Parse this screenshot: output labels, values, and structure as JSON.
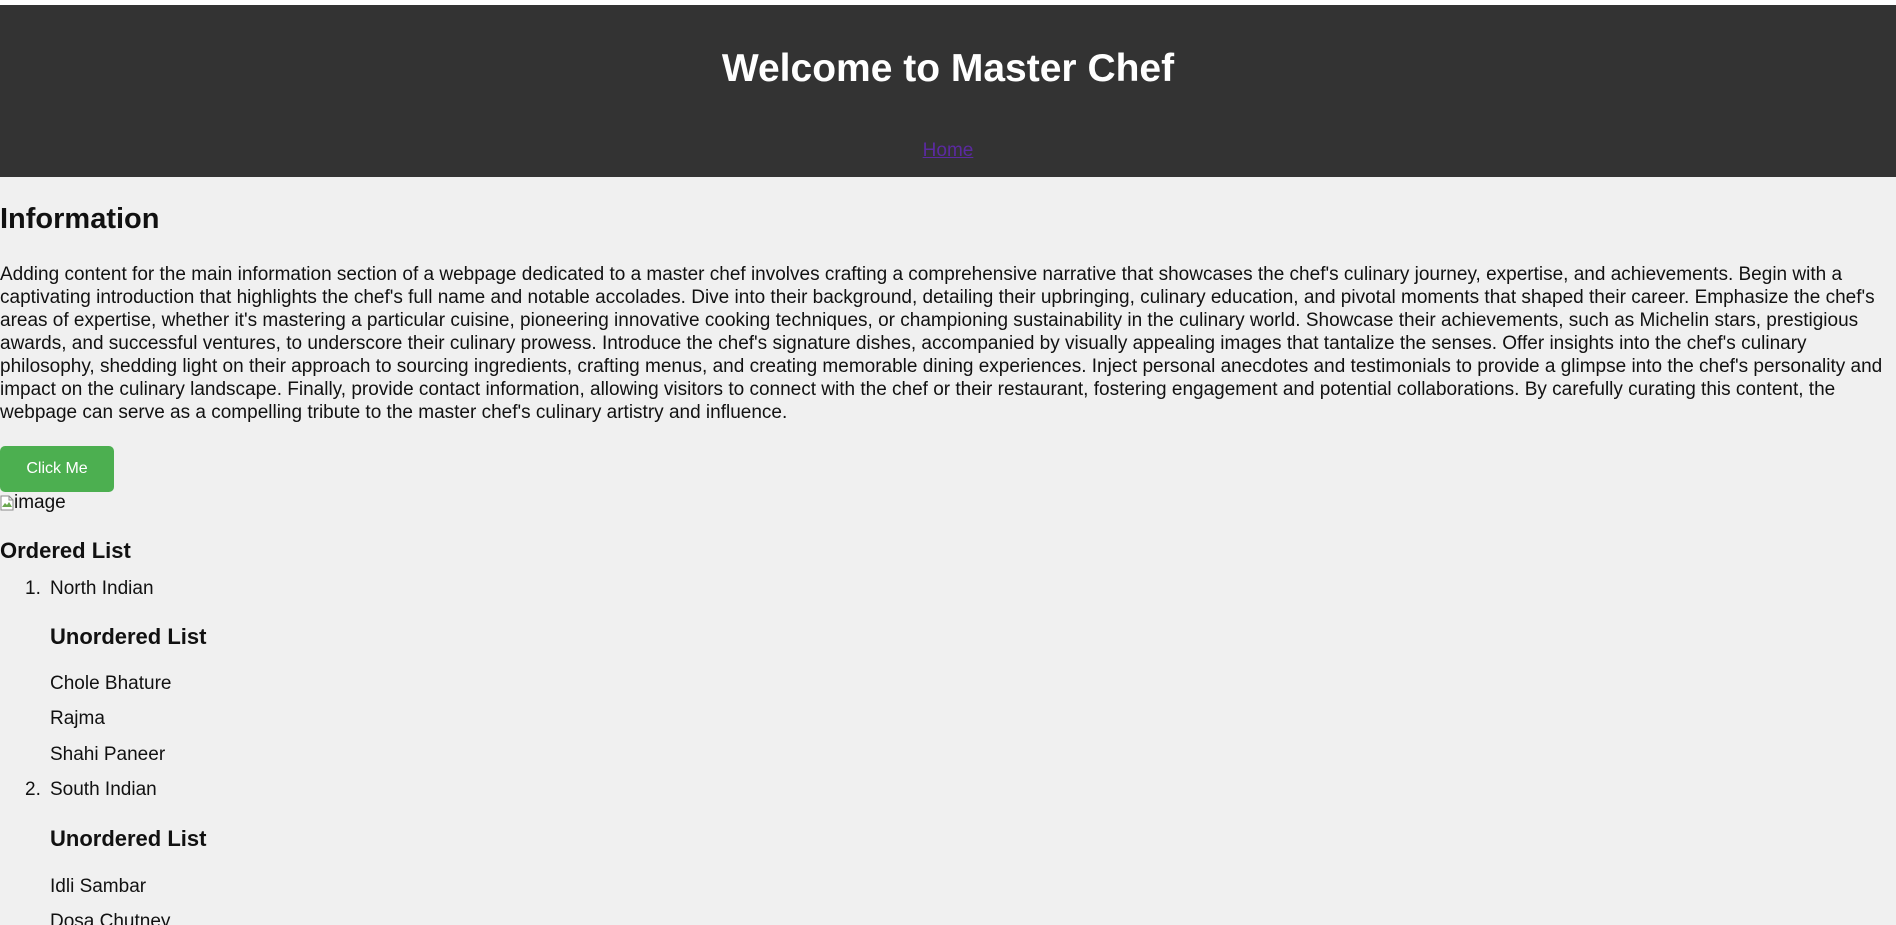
{
  "header": {
    "title": "Welcome to Master Chef",
    "nav": {
      "home_label": "Home"
    }
  },
  "main": {
    "section_title": "Information",
    "paragraph": "Adding content for the main information section of a webpage dedicated to a master chef involves crafting a comprehensive narrative that showcases the chef's culinary journey, expertise, and achievements. Begin with a captivating introduction that highlights the chef's full name and notable accolades. Dive into their background, detailing their upbringing, culinary education, and pivotal moments that shaped their career. Emphasize the chef's areas of expertise, whether it's mastering a particular cuisine, pioneering innovative cooking techniques, or championing sustainability in the culinary world. Showcase their achievements, such as Michelin stars, prestigious awards, and successful ventures, to underscore their culinary prowess. Introduce the chef's signature dishes, accompanied by visually appealing images that tantalize the senses. Offer insights into the chef's culinary philosophy, shedding light on their approach to sourcing ingredients, crafting menus, and creating memorable dining experiences. Inject personal anecdotes and testimonials to provide a glimpse into the chef's personality and impact on the culinary landscape. Finally, provide contact information, allowing visitors to connect with the chef or their restaurant, fostering engagement and potential collaborations. By carefully curating this content, the webpage can serve as a compelling tribute to the master chef's culinary artistry and influence.",
    "button_label": "Click Me",
    "image_alt": "image",
    "ordered_list_title": "Ordered List",
    "ordered_list": [
      {
        "number": "1.",
        "label": "North Indian",
        "sublist_title": "Unordered List",
        "subitems": [
          "Chole Bhature",
          "Rajma",
          "Shahi Paneer"
        ]
      },
      {
        "number": "2.",
        "label": "South Indian",
        "sublist_title": "Unordered List",
        "subitems": [
          "Idli Sambar",
          "Dosa Chutney"
        ]
      }
    ]
  },
  "colors": {
    "header_bg": "#333333",
    "page_bg": "#f0f0f0",
    "button_bg": "#4caf50",
    "link": "#5b2aa0"
  },
  "icons": {
    "broken_image": "broken-image-icon"
  }
}
